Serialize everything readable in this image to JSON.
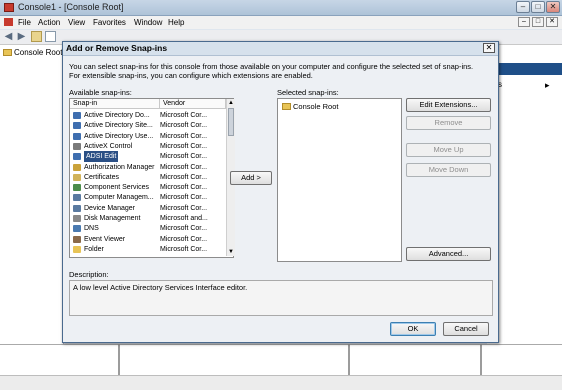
{
  "window": {
    "title": "Console1 - [Console Root]",
    "controls": [
      "–",
      "□",
      "✕"
    ]
  },
  "menubar": {
    "items": [
      "File",
      "Action",
      "View",
      "Favorites",
      "Window",
      "Help"
    ],
    "mdi_controls": [
      "–",
      "□",
      "✕"
    ]
  },
  "tree": {
    "root_label": "Console Root"
  },
  "actions_pane": {
    "item_fragment": "s"
  },
  "dialog": {
    "title": "Add or Remove Snap-ins",
    "close": "✕",
    "intro": "You can select snap-ins for this console from those available on your computer and configure the selected set of snap-ins. For extensible snap-ins, you can configure which extensions are enabled.",
    "available_label": "Available snap-ins:",
    "columns": {
      "snapin": "Snap-in",
      "vendor": "Vendor"
    },
    "available": [
      {
        "name": "Active Directory Do...",
        "vendor": "Microsoft Cor...",
        "icon": "ad-icon",
        "color": "#3f6fb0"
      },
      {
        "name": "Active Directory Site...",
        "vendor": "Microsoft Cor...",
        "icon": "ad-sites-icon",
        "color": "#3f6fb0"
      },
      {
        "name": "Active Directory Use...",
        "vendor": "Microsoft Cor...",
        "icon": "ad-users-icon",
        "color": "#3f6fb0"
      },
      {
        "name": "ActiveX Control",
        "vendor": "Microsoft Cor...",
        "icon": "activex-icon",
        "color": "#7a7a7a"
      },
      {
        "name": "ADSI Edit",
        "vendor": "Microsoft Cor...",
        "icon": "adsi-icon",
        "color": "#3f6fb0"
      },
      {
        "name": "Authorization Manager",
        "vendor": "Microsoft Cor...",
        "icon": "authorization-icon",
        "color": "#caa23a"
      },
      {
        "name": "Certificates",
        "vendor": "Microsoft Cor...",
        "icon": "certificates-icon",
        "color": "#d1b35a"
      },
      {
        "name": "Component Services",
        "vendor": "Microsoft Cor...",
        "icon": "component-services-icon",
        "color": "#4c8c4a"
      },
      {
        "name": "Computer Managem...",
        "vendor": "Microsoft Cor...",
        "icon": "computer-management-icon",
        "color": "#5a7aa0"
      },
      {
        "name": "Device Manager",
        "vendor": "Microsoft Cor...",
        "icon": "device-manager-icon",
        "color": "#5a7aa0"
      },
      {
        "name": "Disk Management",
        "vendor": "Microsoft and...",
        "icon": "disk-icon",
        "color": "#888888"
      },
      {
        "name": "DNS",
        "vendor": "Microsoft Cor...",
        "icon": "dns-icon",
        "color": "#4a7ab0"
      },
      {
        "name": "Event Viewer",
        "vendor": "Microsoft Cor...",
        "icon": "event-viewer-icon",
        "color": "#8a6a4a"
      },
      {
        "name": "Folder",
        "vendor": "Microsoft Cor...",
        "icon": "folder-icon",
        "color": "#e8c456"
      }
    ],
    "selected_index": 4,
    "add_button": "Add >",
    "selected_label": "Selected snap-ins:",
    "selected_root": "Console Root",
    "buttons": {
      "edit_extensions": "Edit Extensions...",
      "remove": "Remove",
      "move_up": "Move Up",
      "move_down": "Move Down",
      "advanced": "Advanced...",
      "ok": "OK",
      "cancel": "Cancel"
    },
    "description_label": "Description:",
    "description": "A low level Active Directory Services Interface editor."
  }
}
